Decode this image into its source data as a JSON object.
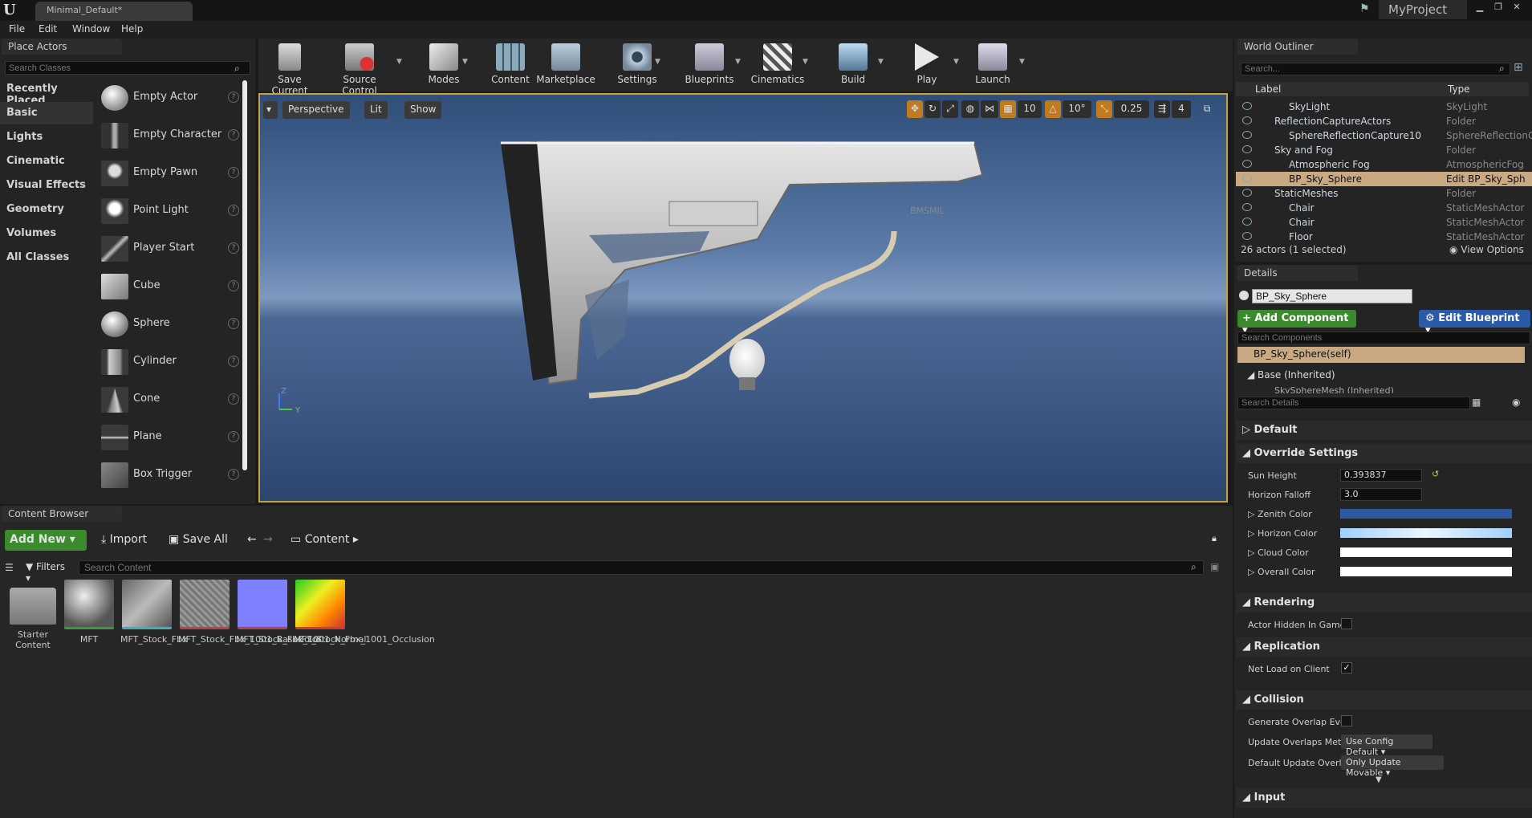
{
  "window": {
    "tab_title": "Minimal_Default*",
    "project": "MyProject"
  },
  "menu": [
    "File",
    "Edit",
    "Window",
    "Help"
  ],
  "place_actors": {
    "tab": "Place Actors",
    "search_placeholder": "Search Classes",
    "categories": [
      "Recently Placed",
      "Basic",
      "Lights",
      "Cinematic",
      "Visual Effects",
      "Geometry",
      "Volumes",
      "All Classes"
    ],
    "selected_category": "Basic",
    "actors": [
      "Empty Actor",
      "Empty Character",
      "Empty Pawn",
      "Point Light",
      "Player Start",
      "Cube",
      "Sphere",
      "Cylinder",
      "Cone",
      "Plane",
      "Box Trigger"
    ]
  },
  "toolbar": {
    "items": [
      "Save Current",
      "Source Control",
      "Modes",
      "Content",
      "Marketplace",
      "Settings",
      "Blueprints",
      "Cinematics",
      "Build",
      "Play",
      "Launch"
    ]
  },
  "viewport": {
    "perspective": "Perspective",
    "lit": "Lit",
    "show": "Show",
    "grid_snap": "10",
    "rotation_snap": "10°",
    "scale_snap": "0.25",
    "camera_speed": "4",
    "gizmo_z": "Z",
    "gizmo_y": "Y",
    "stock_marking": "BMSMIL"
  },
  "world_outliner": {
    "tab": "World Outliner",
    "search_placeholder": "Search...",
    "col_label": "Label",
    "col_type": "Type",
    "rows": [
      {
        "label": "SkyLight",
        "type": "SkyLight",
        "indent": 3,
        "selected": false
      },
      {
        "label": "ReflectionCaptureActors",
        "type": "Folder",
        "indent": 2,
        "selected": false
      },
      {
        "label": "SphereReflectionCapture10",
        "type": "SphereReflectionC",
        "indent": 3,
        "selected": false
      },
      {
        "label": "Sky and Fog",
        "type": "Folder",
        "indent": 2,
        "selected": false
      },
      {
        "label": "Atmospheric Fog",
        "type": "AtmosphericFog",
        "indent": 3,
        "selected": false
      },
      {
        "label": "BP_Sky_Sphere",
        "type": "Edit BP_Sky_Sph",
        "indent": 3,
        "selected": true
      },
      {
        "label": "StaticMeshes",
        "type": "Folder",
        "indent": 2,
        "selected": false
      },
      {
        "label": "Chair",
        "type": "StaticMeshActor",
        "indent": 3,
        "selected": false
      },
      {
        "label": "Chair",
        "type": "StaticMeshActor",
        "indent": 3,
        "selected": false
      },
      {
        "label": "Floor",
        "type": "StaticMeshActor",
        "indent": 3,
        "selected": false
      }
    ],
    "status": "26 actors (1 selected)",
    "view_options": "View Options"
  },
  "details": {
    "tab": "Details",
    "name_value": "BP_Sky_Sphere",
    "add_component": "Add Component",
    "edit_blueprint": "Edit Blueprint",
    "search_components": "Search Components",
    "self_component": "BP_Sky_Sphere(self)",
    "base_inherited": "Base (Inherited)",
    "sky_mesh": "SkySphereMesh (Inherited)",
    "search_details": "Search Details",
    "sections": {
      "default": "Default",
      "override": "Override Settings",
      "rendering": "Rendering",
      "replication": "Replication",
      "collision": "Collision",
      "input": "Input"
    },
    "props": {
      "sun_height_label": "Sun Height",
      "sun_height": "0.393837",
      "horizon_falloff_label": "Horizon Falloff",
      "horizon_falloff": "3.0",
      "zenith_label": "Zenith Color",
      "horizon_color_label": "Horizon Color",
      "cloud_label": "Cloud Color",
      "overall_label": "Overall Color",
      "hidden_label": "Actor Hidden In Game",
      "net_load_label": "Net Load on Client",
      "overlap_events_label": "Generate Overlap Ever",
      "update_overlaps_label": "Update Overlaps Meth",
      "update_overlaps_value": "Use Config Default",
      "default_update_label": "Default Update Overla",
      "default_update_value": "Only Update Movable"
    },
    "colors": {
      "zenith": "#2f5aa0",
      "horizon": "#cfe6ff",
      "cloud": "#ffffff",
      "overall": "#ffffff"
    }
  },
  "content_browser": {
    "tab": "Content Browser",
    "add_new": "Add New",
    "import": "Import",
    "save_all": "Save All",
    "path": "Content",
    "filters": "Filters",
    "search_placeholder": "Search Content",
    "assets": [
      {
        "name": "Starter Content",
        "kind": "folder"
      },
      {
        "name": "MFT",
        "kind": "material"
      },
      {
        "name": "MFT_Stock_Fbx",
        "kind": "mesh"
      },
      {
        "name": "MFT_Stock_Fbx_1001_BaseColor",
        "kind": "texture-gray"
      },
      {
        "name": "MFT_Stock_Fbx_1001_Normal",
        "kind": "texture-normal"
      },
      {
        "name": "MFT_Stock_Fbx_1001_Occlusion",
        "kind": "texture-occ"
      }
    ]
  }
}
